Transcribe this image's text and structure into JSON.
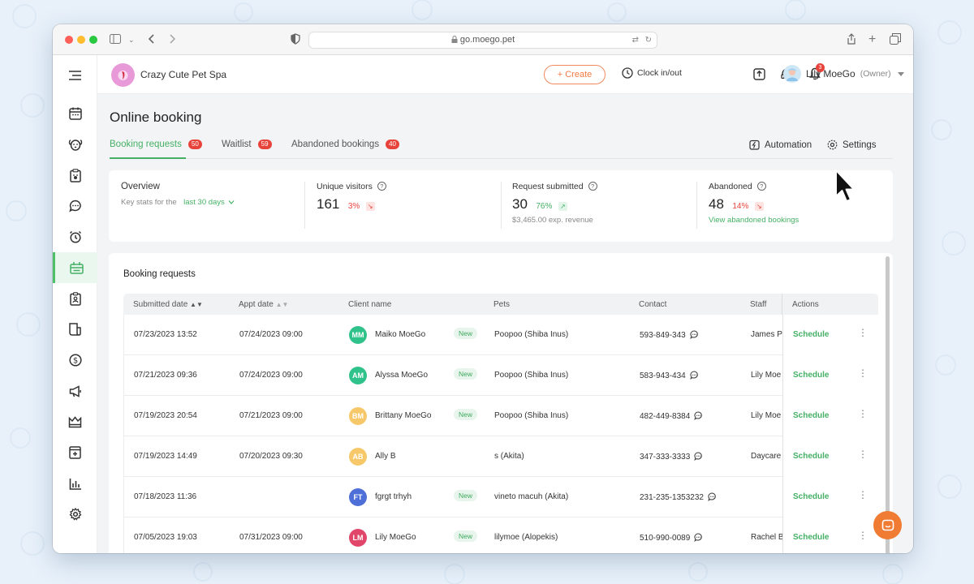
{
  "browser": {
    "url": "go.moego.pet"
  },
  "header": {
    "business_name": "Crazy Cute Pet Spa",
    "create_label": "+ Create",
    "clock_label": "Clock in/out",
    "notification_count": "3",
    "user_name": "Lily MoeGo",
    "user_role": "(Owner)"
  },
  "page": {
    "title": "Online booking",
    "tabs": [
      {
        "label": "Booking requests",
        "count": "50"
      },
      {
        "label": "Waitlist",
        "count": "59"
      },
      {
        "label": "Abandoned bookings",
        "count": "40"
      }
    ],
    "automation_label": "Automation",
    "settings_label": "Settings"
  },
  "overview": {
    "title": "Overview",
    "subtitle": "Key stats for the",
    "period": "last 30 days",
    "stats": [
      {
        "label": "Unique visitors",
        "value": "161",
        "change": "3%",
        "direction": "down"
      },
      {
        "label": "Request submitted",
        "value": "30",
        "change": "76%",
        "direction": "up",
        "note": "$3,465.00 exp. revenue"
      },
      {
        "label": "Abandoned",
        "value": "48",
        "change": "14%",
        "direction": "down",
        "link": "View abandoned bookings"
      }
    ]
  },
  "requests": {
    "title": "Booking requests",
    "columns": [
      "Submitted date",
      "Appt date",
      "Client name",
      "Pets",
      "Contact",
      "Staff",
      "Actions"
    ],
    "new_label": "New",
    "action_label": "Schedule",
    "rows": [
      {
        "submitted": "07/23/2023 13:52",
        "appt": "07/24/2023 09:00",
        "initials": "MM",
        "avatar_color": "#2fc28b",
        "client": "Maiko MoeGo",
        "new": true,
        "pets": "Poopoo (Shiba Inus)",
        "contact": "593-849-343",
        "staff": "James Pe"
      },
      {
        "submitted": "07/21/2023 09:36",
        "appt": "07/24/2023 09:00",
        "initials": "AM",
        "avatar_color": "#2fc28b",
        "client": "Alyssa MoeGo",
        "new": true,
        "pets": "Poopoo (Shiba Inus)",
        "contact": "583-943-434",
        "staff": "Lily Moe"
      },
      {
        "submitted": "07/19/2023 20:54",
        "appt": "07/21/2023 09:00",
        "initials": "BM",
        "avatar_color": "#f6c86a",
        "client": "Brittany MoeGo",
        "new": true,
        "pets": "Poopoo (Shiba Inus)",
        "contact": "482-449-8384",
        "staff": "Lily Moe"
      },
      {
        "submitted": "07/19/2023 14:49",
        "appt": "07/20/2023 09:30",
        "initials": "AB",
        "avatar_color": "#f6c86a",
        "client": "Ally B",
        "new": false,
        "pets": "s (Akita)",
        "contact": "347-333-3333",
        "staff": "Daycare"
      },
      {
        "submitted": "07/18/2023 11:36",
        "appt": "",
        "initials": "FT",
        "avatar_color": "#4f6fd8",
        "client": "fgrgt trhyh",
        "new": true,
        "pets": "vineto macuh (Akita)",
        "contact": "231-235-1353232",
        "staff": ""
      },
      {
        "submitted": "07/05/2023 19:03",
        "appt": "07/31/2023 09:00",
        "initials": "LM",
        "avatar_color": "#e2456a",
        "client": "Lily MoeGo",
        "new": true,
        "pets": "lilymoe (Alopekis)",
        "contact": "510-990-0089",
        "staff": "Rachel B"
      }
    ]
  },
  "colors": {
    "accent_green": "#45b065",
    "accent_orange": "#f07b43",
    "badge_red": "#e8433b"
  }
}
